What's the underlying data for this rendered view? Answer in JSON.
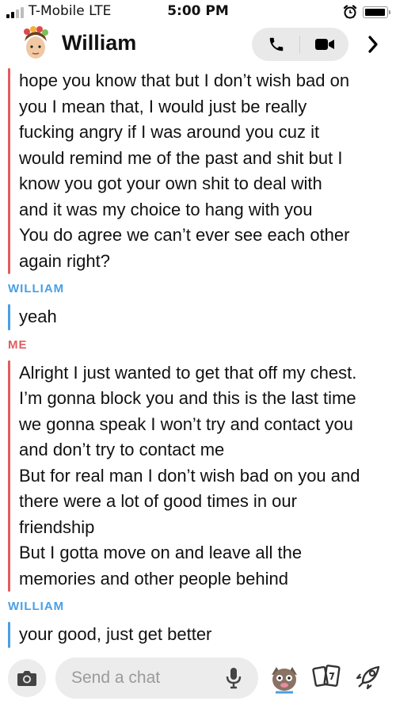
{
  "status_bar": {
    "carrier": "T-Mobile  LTE",
    "time": "5:00 PM",
    "signal_bars": 2,
    "signal_total": 4,
    "battery_level": 0.96
  },
  "header": {
    "contact_name": "William"
  },
  "colors": {
    "me": "#e15c61",
    "them": "#4a9fe3"
  },
  "messages": [
    {
      "sender": "",
      "from": "me",
      "lines": [
        "hope you know that but I don’t wish bad on",
        "you I mean that, I would just be really",
        "fucking angry if I was around you cuz it",
        "would remind me of the past and shit but I",
        "know you got your own shit to deal with",
        "and it was my choice to hang with you",
        "You do agree we can’t ever see each other",
        "again right?"
      ]
    },
    {
      "sender": "WILLIAM",
      "from": "them",
      "lines": [
        "yeah"
      ]
    },
    {
      "sender": "ME",
      "from": "me",
      "lines": [
        "Alright I just wanted to get that off my chest.",
        "I’m gonna block you and this is the last time",
        "we gonna speak I won’t try and contact you",
        "and don’t try to contact me",
        "But for real man I don’t wish bad on you and",
        "there were a lot of good times in our",
        "friendship",
        "But I gotta move on and leave all the",
        "memories and other people behind"
      ]
    },
    {
      "sender": "WILLIAM",
      "from": "them",
      "lines": [
        "your good, just get better"
      ]
    }
  ],
  "composer": {
    "placeholder": "Send a chat"
  },
  "icons": {
    "camera": "camera-icon",
    "mic": "microphone-icon",
    "bitmoji": "bitmoji-icon",
    "stickers": "sticker-cards-icon",
    "games": "rocket-icon",
    "phone": "phone-icon",
    "video": "video-camera-icon",
    "chevron": "chevron-right-icon",
    "alarm": "alarm-clock-icon"
  }
}
